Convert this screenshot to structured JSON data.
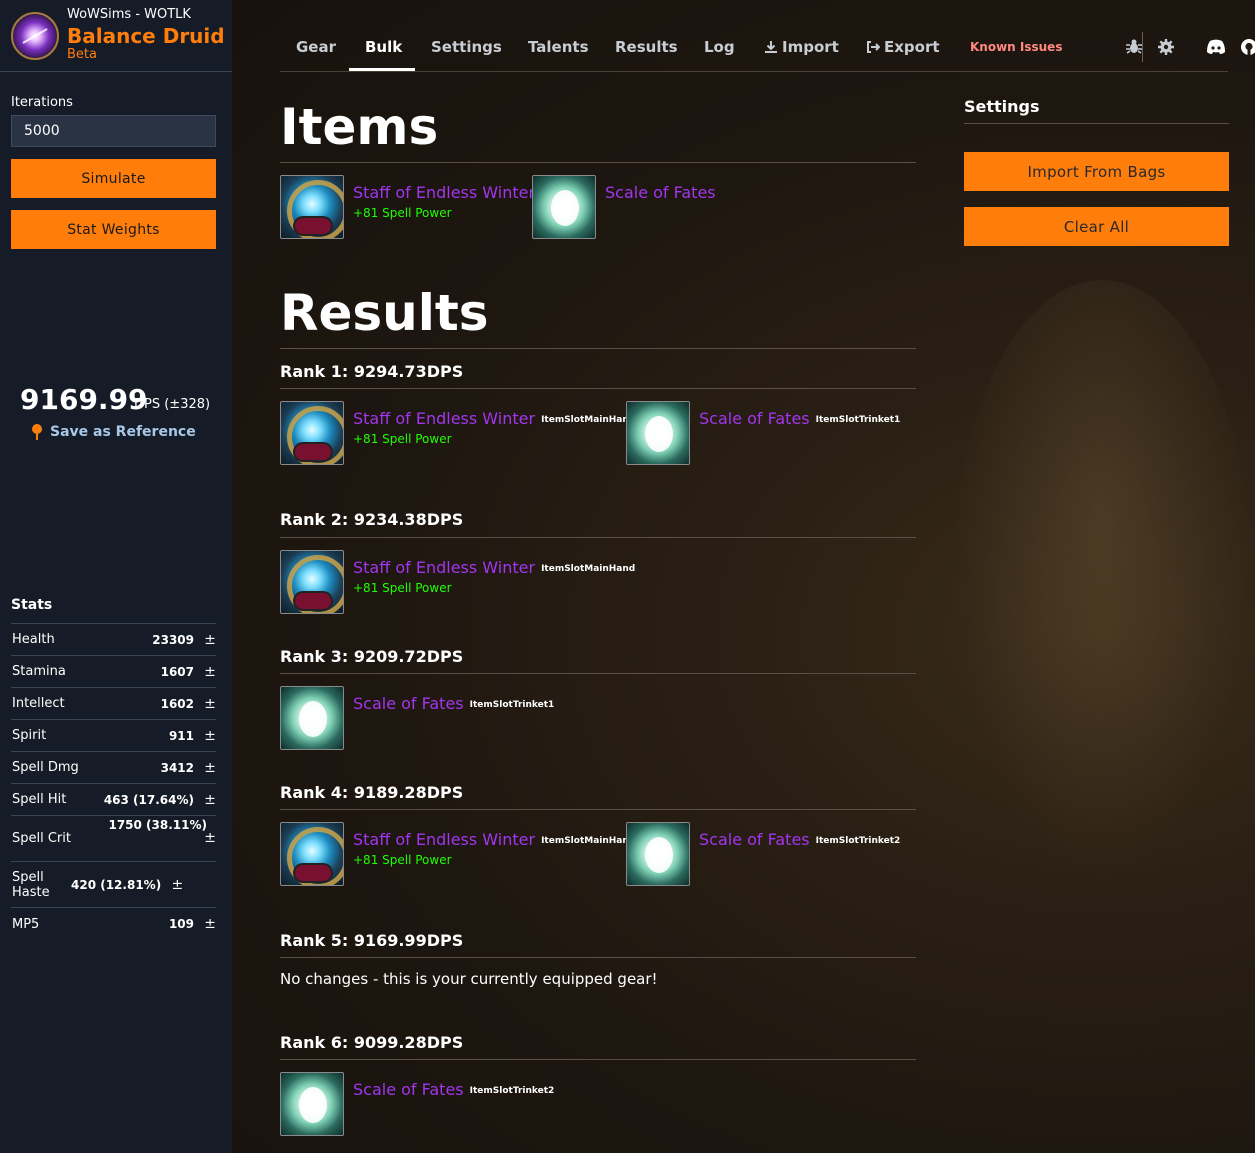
{
  "sidebar": {
    "app_name": "WoWSims - WOTLK",
    "spec_name": "Balance Druid",
    "beta": "Beta",
    "iterations_label": "Iterations",
    "iterations_value": "5000",
    "simulate_label": "Simulate",
    "stat_weights_label": "Stat Weights",
    "dps_value": "9169.99",
    "dps_unit": "DPS (±328)",
    "save_reference_label": "Save as Reference",
    "stats_title": "Stats",
    "stats": [
      {
        "name": "Health",
        "value": "23309",
        "pm": "±"
      },
      {
        "name": "Stamina",
        "value": "1607",
        "pm": "±"
      },
      {
        "name": "Intellect",
        "value": "1602",
        "pm": "±"
      },
      {
        "name": "Spirit",
        "value": "911",
        "pm": "±"
      },
      {
        "name": "Spell Dmg",
        "value": "3412",
        "pm": "±"
      },
      {
        "name": "Spell Hit",
        "value": "463 (17.64%)",
        "pm": "±"
      },
      {
        "name": "Spell Crit",
        "value": "1750 (38.11%)",
        "pm": "±"
      },
      {
        "name": "Spell Haste",
        "value": "420 (12.81%)",
        "pm": "±"
      },
      {
        "name": "MP5",
        "value": "109",
        "pm": "±"
      }
    ]
  },
  "nav": {
    "gear": "Gear",
    "bulk": "Bulk",
    "settings": "Settings",
    "talents": "Talents",
    "results": "Results",
    "log": "Log",
    "import": "Import",
    "export": "Export",
    "known_issues": "Known Issues",
    "active": "Bulk"
  },
  "items_section": {
    "title": "Items",
    "items": [
      {
        "name": "Staff of Endless Winter",
        "bonus": "+81 Spell Power",
        "icon": "staff-icon"
      },
      {
        "name": "Scale of Fates",
        "icon": "scale-icon"
      }
    ]
  },
  "results_section": {
    "title": "Results",
    "ranks": [
      {
        "title": "Rank 1: 9294.73DPS",
        "items": [
          {
            "name": "Staff of Endless Winter",
            "slot": "ItemSlotMainHand",
            "bonus": "+81 Spell Power"
          },
          {
            "name": "Scale of Fates",
            "slot": "ItemSlotTrinket1"
          }
        ]
      },
      {
        "title": "Rank 2: 9234.38DPS",
        "items": [
          {
            "name": "Staff of Endless Winter",
            "slot": "ItemSlotMainHand",
            "bonus": "+81 Spell Power"
          }
        ]
      },
      {
        "title": "Rank 3: 9209.72DPS",
        "items": [
          {
            "name": "Scale of Fates",
            "slot": "ItemSlotTrinket1"
          }
        ]
      },
      {
        "title": "Rank 4: 9189.28DPS",
        "items": [
          {
            "name": "Staff of Endless Winter",
            "slot": "ItemSlotMainHand",
            "bonus": "+81 Spell Power"
          },
          {
            "name": "Scale of Fates",
            "slot": "ItemSlotTrinket2"
          }
        ]
      },
      {
        "title": "Rank 5: 9169.99DPS",
        "note": "No changes - this is your currently equipped gear!"
      },
      {
        "title": "Rank 6: 9099.28DPS",
        "items": [
          {
            "name": "Scale of Fates",
            "slot": "ItemSlotTrinket2"
          }
        ]
      }
    ]
  },
  "settings_panel": {
    "title": "Settings",
    "import_from_bags": "Import From Bags",
    "clear_all": "Clear All"
  },
  "colors": {
    "accent": "#ff7d0a",
    "epic": "#a335ee",
    "uncommon": "#1eff00",
    "sidebar_bg": "#161c27"
  }
}
